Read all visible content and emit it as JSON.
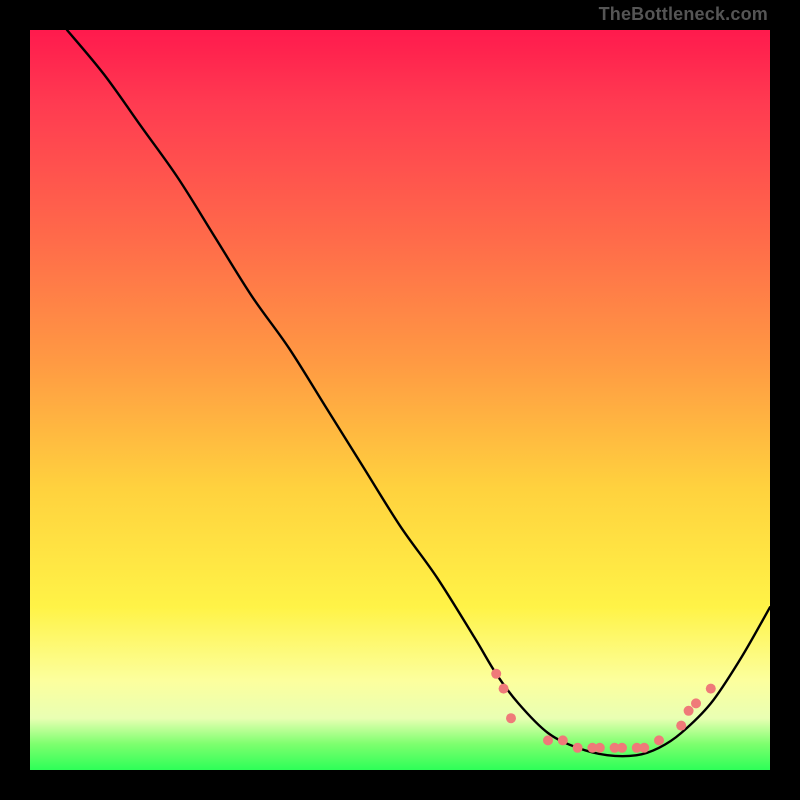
{
  "watermark": "TheBottleneck.com",
  "chart_data": {
    "type": "line",
    "title": "",
    "xlabel": "",
    "ylabel": "",
    "xlim": [
      0,
      100
    ],
    "ylim": [
      0,
      100
    ],
    "grid": false,
    "legend": false,
    "series": [
      {
        "name": "curve",
        "x": [
          5,
          10,
          15,
          20,
          25,
          30,
          35,
          40,
          45,
          50,
          55,
          60,
          63,
          66,
          70,
          74,
          78,
          82,
          85,
          88,
          92,
          96,
          100
        ],
        "y": [
          100,
          94,
          87,
          80,
          72,
          64,
          57,
          49,
          41,
          33,
          26,
          18,
          13,
          9,
          5,
          3,
          2,
          2,
          3,
          5,
          9,
          15,
          22
        ]
      }
    ],
    "markers": [
      {
        "name": "marker",
        "x": 63,
        "y": 13
      },
      {
        "name": "marker",
        "x": 64,
        "y": 11
      },
      {
        "name": "marker",
        "x": 65,
        "y": 7
      },
      {
        "name": "marker",
        "x": 70,
        "y": 4
      },
      {
        "name": "marker",
        "x": 72,
        "y": 4
      },
      {
        "name": "marker",
        "x": 74,
        "y": 3
      },
      {
        "name": "marker",
        "x": 76,
        "y": 3
      },
      {
        "name": "marker",
        "x": 77,
        "y": 3
      },
      {
        "name": "marker",
        "x": 79,
        "y": 3
      },
      {
        "name": "marker",
        "x": 80,
        "y": 3
      },
      {
        "name": "marker",
        "x": 82,
        "y": 3
      },
      {
        "name": "marker",
        "x": 83,
        "y": 3
      },
      {
        "name": "marker",
        "x": 85,
        "y": 4
      },
      {
        "name": "marker",
        "x": 88,
        "y": 6
      },
      {
        "name": "marker",
        "x": 89,
        "y": 8
      },
      {
        "name": "marker",
        "x": 90,
        "y": 9
      },
      {
        "name": "marker",
        "x": 92,
        "y": 11
      }
    ],
    "marker_radius_px": 5,
    "background_gradient": {
      "stops": [
        {
          "pos": 0.0,
          "color": "#ff1a4d"
        },
        {
          "pos": 0.28,
          "color": "#ff6a4a"
        },
        {
          "pos": 0.62,
          "color": "#ffd23e"
        },
        {
          "pos": 0.88,
          "color": "#fcff9e"
        },
        {
          "pos": 1.0,
          "color": "#2dff58"
        }
      ]
    }
  }
}
